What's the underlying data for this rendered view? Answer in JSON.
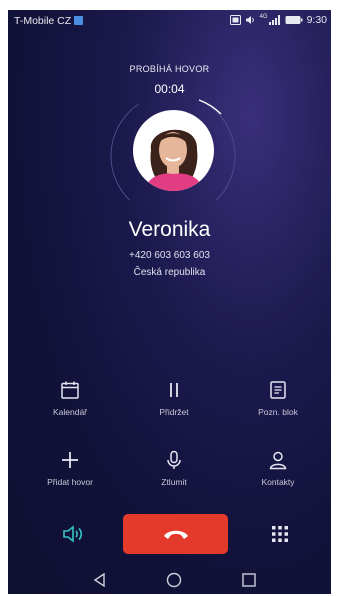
{
  "status_bar": {
    "carrier": "T-Mobile CZ",
    "network": "4G",
    "time": "9:30"
  },
  "call": {
    "status": "PROBÍHÁ HOVOR",
    "duration": "00:04",
    "contact_name": "Veronika",
    "phone_number": "+420 603 603 603",
    "country": "Česká republika"
  },
  "actions": [
    {
      "label": "Kalendář",
      "icon": "calendar-icon"
    },
    {
      "label": "Přidržet",
      "icon": "pause-icon"
    },
    {
      "label": "Pozn. blok",
      "icon": "notepad-icon"
    },
    {
      "label": "Přidat hovor",
      "icon": "add-call-icon"
    },
    {
      "label": "Ztlumit",
      "icon": "microphone-icon"
    },
    {
      "label": "Kontakty",
      "icon": "contacts-icon"
    }
  ],
  "bottom_bar": {
    "speaker_icon": "speaker-icon",
    "end_call_icon": "hang-up-icon",
    "dialpad_icon": "dialpad-icon"
  },
  "colors": {
    "end_call": "#e33a2b",
    "speaker_active": "#35c6c8",
    "background": "#161640"
  }
}
